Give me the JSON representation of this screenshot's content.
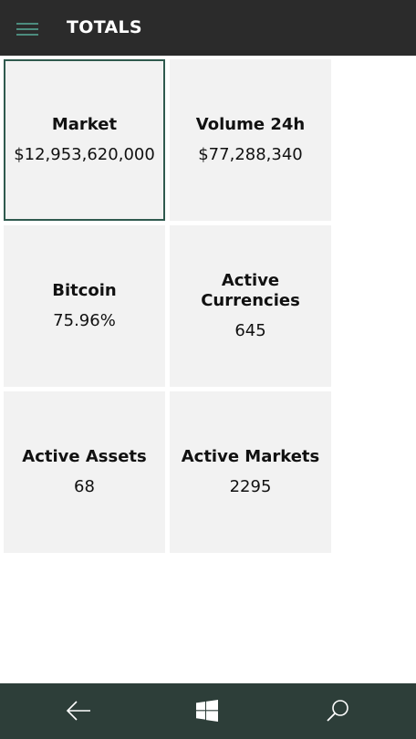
{
  "header": {
    "title": "TOTALS",
    "menu_icon": "hamburger-menu-icon",
    "menu_icon_color": "#4c8c7e",
    "background": "#2b2b2b"
  },
  "tiles": [
    {
      "label": "Market",
      "value": "$12,953,620,000",
      "selected": true
    },
    {
      "label": "Volume 24h",
      "value": "$77,288,340",
      "selected": false
    },
    {
      "label": "Bitcoin",
      "value": "75.96%",
      "selected": false
    },
    {
      "label": "Active Currencies",
      "value": "645",
      "selected": false
    },
    {
      "label": "Active Assets",
      "value": "68",
      "selected": false
    },
    {
      "label": "Active Markets",
      "value": "2295",
      "selected": false
    }
  ],
  "appbar": {
    "buttons": [
      "back-arrow-icon",
      "windows-logo-icon",
      "search-icon"
    ],
    "background": "#2d3e39"
  },
  "colors": {
    "tile_background": "#f2f2f2",
    "selected_border": "#2f5a4e"
  }
}
